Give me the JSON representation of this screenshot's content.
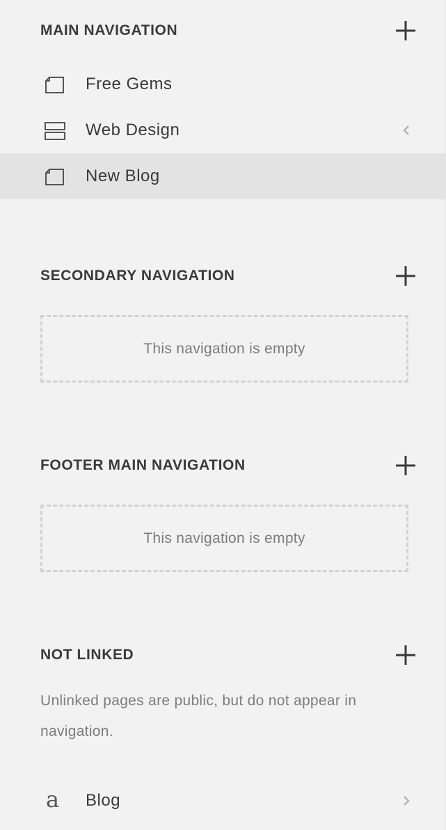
{
  "colors": {
    "background": "#f2f2f2",
    "selected_row": "#e3e3e3",
    "text_primary": "#3a3a3a",
    "text_muted": "#7d7d7d",
    "dashed_border": "#d2d2d2"
  },
  "sections": {
    "main": {
      "title": "MAIN NAVIGATION",
      "add_icon": "plus-icon",
      "items": [
        {
          "label": "Free Gems",
          "icon": "page-icon",
          "chevron": null,
          "selected": false
        },
        {
          "label": "Web Design",
          "icon": "index-icon",
          "chevron": "chevron-left-icon",
          "selected": false
        },
        {
          "label": "New Blog",
          "icon": "page-icon",
          "chevron": null,
          "selected": true
        }
      ]
    },
    "secondary": {
      "title": "SECONDARY NAVIGATION",
      "add_icon": "plus-icon",
      "empty_text": "This navigation is empty"
    },
    "footer": {
      "title": "FOOTER MAIN NAVIGATION",
      "add_icon": "plus-icon",
      "empty_text": "This navigation is empty"
    },
    "not_linked": {
      "title": "NOT LINKED",
      "add_icon": "plus-icon",
      "description": "Unlinked pages are public, but do not appear in navigation.",
      "items": [
        {
          "label": "Blog",
          "icon": "blog-letter-icon",
          "icon_glyph": "a",
          "chevron": "chevron-right-icon"
        }
      ]
    }
  }
}
